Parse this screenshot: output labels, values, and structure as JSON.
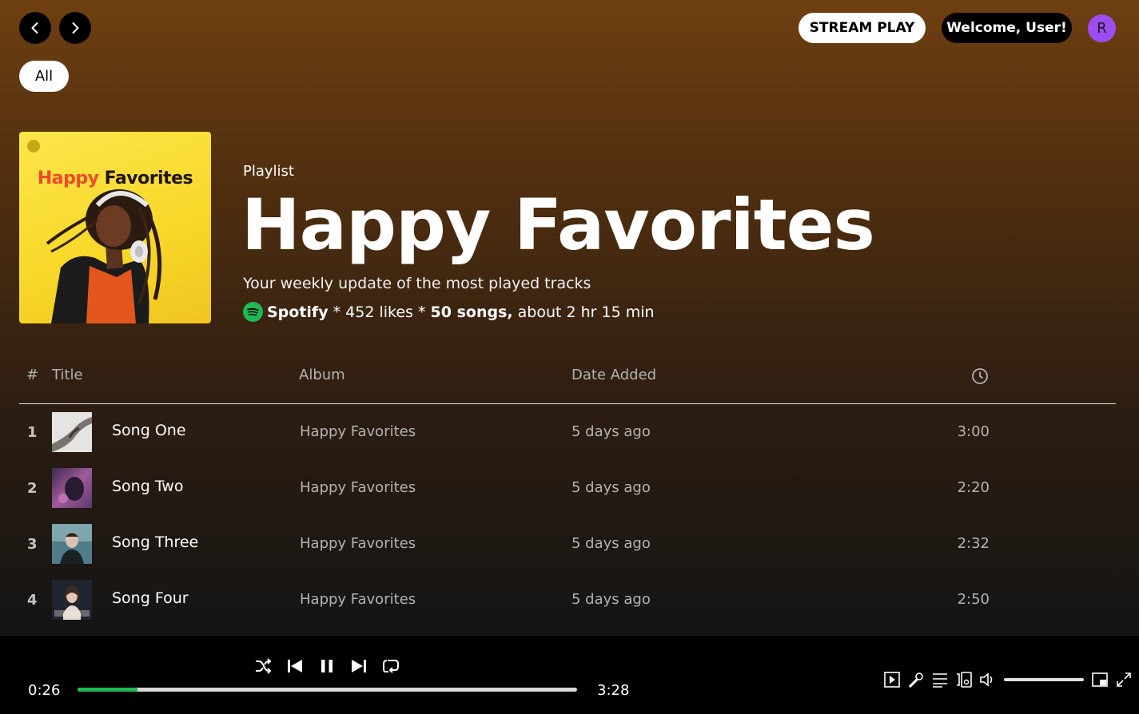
{
  "header": {
    "stream_play_label": "STREAM PLAY",
    "welcome_label": "Welcome, User!",
    "avatar_initial": "R"
  },
  "filters": {
    "all_label": "All"
  },
  "playlist": {
    "type_label": "Playlist",
    "title": "Happy Favorites",
    "cover_title_word1": "Happy",
    "cover_title_word2": "Favorites",
    "description": "Your weekly update of the most played tracks",
    "owner": "Spotify",
    "likes_text": " * 452 likes * ",
    "songs_text": "50 songs,",
    "duration_text": " about 2 hr 15 min"
  },
  "table": {
    "headers": {
      "num": "#",
      "title": "Title",
      "album": "Album",
      "date": "Date Added",
      "duration_icon": "clock-icon"
    },
    "rows": [
      {
        "num": "1",
        "title": "Song One",
        "album": "Happy Favorites",
        "date": "5 days ago",
        "duration": "3:00"
      },
      {
        "num": "2",
        "title": "Song Two",
        "album": "Happy Favorites",
        "date": "5 days ago",
        "duration": "2:20"
      },
      {
        "num": "3",
        "title": "Song Three",
        "album": "Happy Favorites",
        "date": "5 days ago",
        "duration": "2:32"
      },
      {
        "num": "4",
        "title": "Song Four",
        "album": "Happy Favorites",
        "date": "5 days ago",
        "duration": "2:50"
      }
    ]
  },
  "player": {
    "current_time": "0:26",
    "total_time": "3:28",
    "progress_fraction": 0.12,
    "volume_fraction": 1.0,
    "controls": [
      "shuffle-icon",
      "previous-icon",
      "pause-icon",
      "next-icon",
      "repeat-icon"
    ],
    "right_icons": [
      "now-playing-view-icon",
      "lyrics-icon",
      "queue-icon",
      "connect-device-icon",
      "volume-icon",
      "mini-player-icon",
      "fullscreen-icon"
    ]
  },
  "colors": {
    "accent": "#1db954",
    "avatar_bg": "#9d4cf0",
    "header_gradient_top": "#6e3f10",
    "cover_yellow": "#fde64a"
  }
}
